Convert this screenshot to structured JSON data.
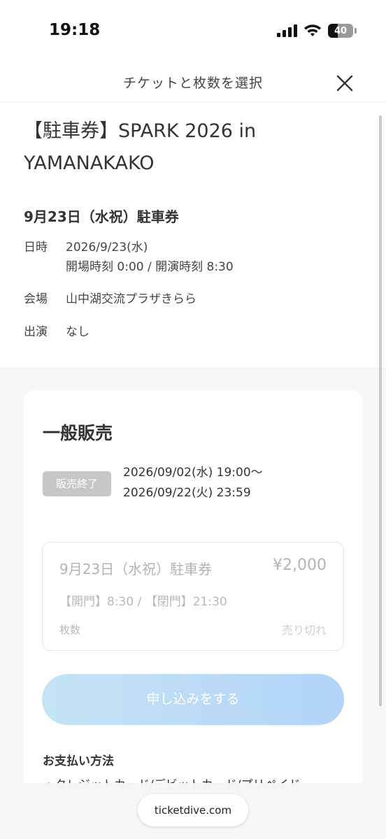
{
  "status_bar": {
    "time": "19:18",
    "battery_level": "40",
    "icons": [
      "signal-icon",
      "wifi-icon",
      "battery-icon"
    ]
  },
  "header": {
    "title": "チケットと枚数を選択",
    "close_icon": "close-icon"
  },
  "event": {
    "title": "【駐車券】SPARK 2026 in YAMANAKAKO",
    "date_heading": "9月23日（水祝）駐車券",
    "datetime_label": "日時",
    "datetime_value": "2026/9/23(水)",
    "times_value": "開場時刻 0:00 / 開演時刻 8:30",
    "venue_label": "会場",
    "venue_value": "山中湖交流プラザきらら",
    "performers_label": "出演",
    "performers_value": "なし"
  },
  "sale": {
    "title": "一般販売",
    "status_badge": "販売終了",
    "period_start": "2026/09/02(水) 19:00〜",
    "period_end": "2026/09/22(火) 23:59",
    "ticket": {
      "name": "9月23日（水祝）駐車券",
      "price": "¥2,000",
      "gates": "【開門】8:30 / 【閉門】21:30",
      "quantity_label": "枚数",
      "availability": "売り切れ"
    },
    "apply_button": "申し込みをする",
    "payment_heading": "お支払い方法",
    "payment_item": "・クレジットカード/デビットカード/プリペイド"
  },
  "browser": {
    "url": "ticketdive.com"
  },
  "colors": {
    "button_gradient_start": "#c3e4f4",
    "button_gradient_end": "#b3d3f8",
    "badge_bg": "#c6c6c6",
    "page_bg": "#f5f6f8"
  }
}
